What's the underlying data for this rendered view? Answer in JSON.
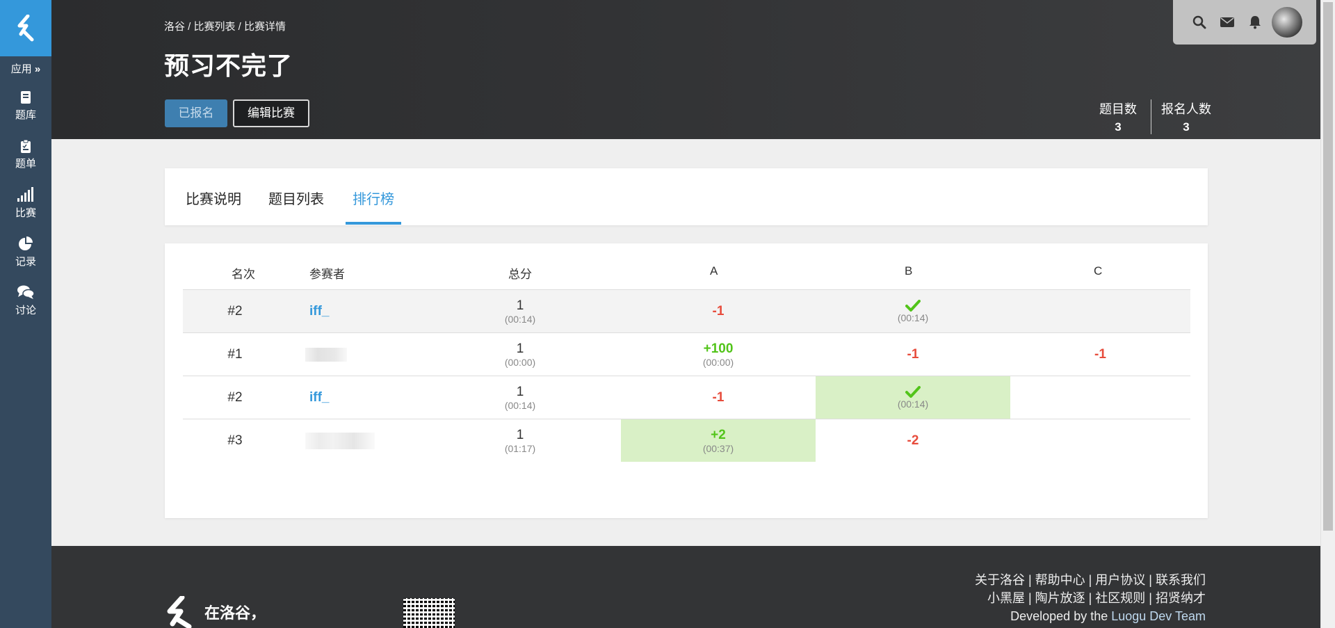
{
  "sidebar": {
    "app_label": "应用",
    "items": [
      {
        "label": "题库",
        "icon": "book-icon"
      },
      {
        "label": "题单",
        "icon": "clipboard-icon"
      },
      {
        "label": "比赛",
        "icon": "bar-chart-icon"
      },
      {
        "label": "记录",
        "icon": "pie-chart-icon"
      },
      {
        "label": "讨论",
        "icon": "comments-icon"
      }
    ]
  },
  "header": {
    "breadcrumb": "洛谷 / 比赛列表 / 比赛详情",
    "title": "预习不完了",
    "registered_label": "已报名",
    "edit_label": "编辑比赛",
    "stats": {
      "problems_label": "题目数",
      "problems_value": "3",
      "participants_label": "报名人数",
      "participants_value": "3"
    }
  },
  "tabs": [
    {
      "label": "比赛说明",
      "active": false
    },
    {
      "label": "题目列表",
      "active": false
    },
    {
      "label": "排行榜",
      "active": true
    }
  ],
  "ranking": {
    "columns": [
      "名次",
      "参赛者",
      "总分",
      "A",
      "B",
      "C"
    ],
    "rows": [
      {
        "rank": "#2",
        "user": "iff_",
        "score": "1",
        "time": "(00:14)",
        "A": "-1",
        "B_time": "(00:14)"
      },
      {
        "rank": "#1",
        "user": "",
        "score": "1",
        "time": "(00:00)",
        "A": "+100",
        "A_time": "(00:00)",
        "B": "-1",
        "C": "-1"
      },
      {
        "rank": "#2",
        "user": "iff_",
        "score": "1",
        "time": "(00:14)",
        "A": "-1",
        "B_time": "(00:14)"
      },
      {
        "rank": "#3",
        "user": "",
        "score": "1",
        "time": "(01:17)",
        "A": "+2",
        "A_time": "(00:37)",
        "B": "-2"
      }
    ]
  },
  "footer": {
    "links_line1": "关于洛谷 | 帮助中心 | 用户协议 | 联系我们",
    "links_line2": "小黑屋 | 陶片放逐 | 社区规则 | 招贤纳才",
    "dev_prefix": "Developed by the ",
    "dev_team": "Luogu Dev Team",
    "slogan": "在洛谷，"
  },
  "colors": {
    "accent": "#3498db",
    "sidebar": "#34495e",
    "positive": "#52c41a",
    "negative": "#e74c3c",
    "first_blood": "#d9f0c6"
  }
}
